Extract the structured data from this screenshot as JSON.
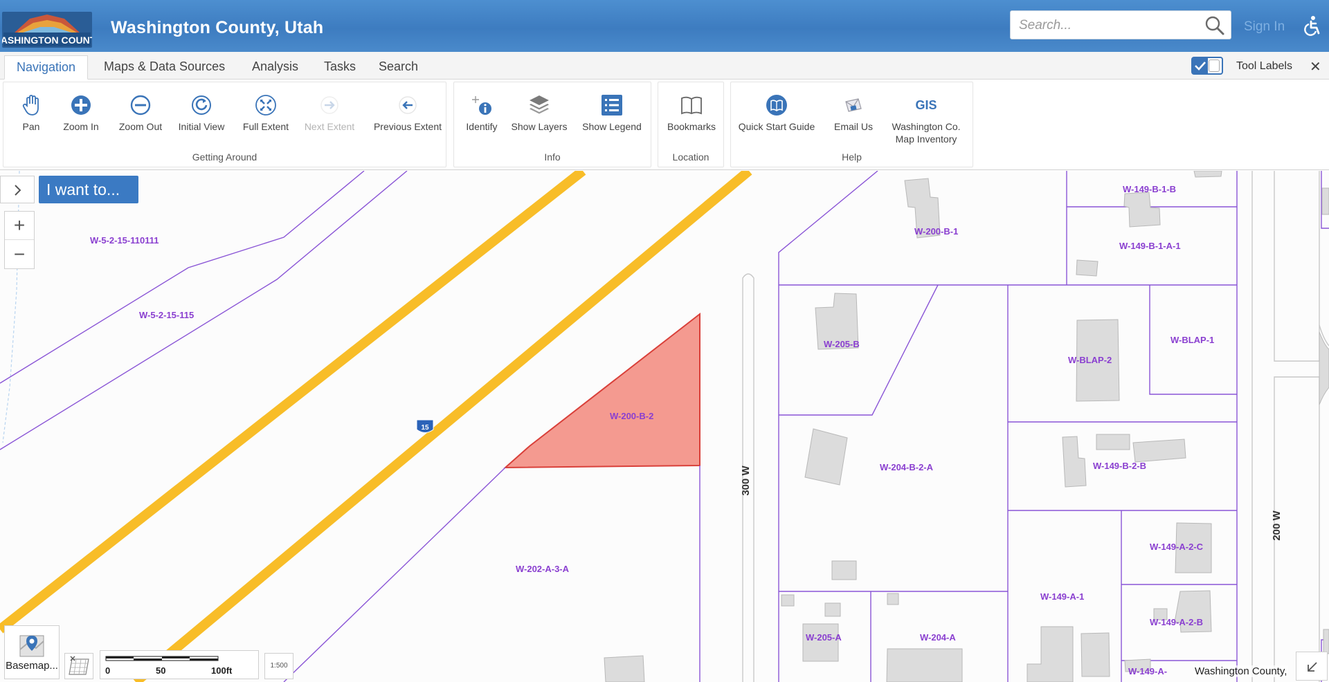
{
  "header": {
    "logo_text": "WASHINGTON COUNTY",
    "title": "Washington County, Utah",
    "search_placeholder": "Search...",
    "sign_in": "Sign In"
  },
  "tabs": [
    {
      "label": "Navigation",
      "active": true
    },
    {
      "label": "Maps & Data Sources",
      "active": false
    },
    {
      "label": "Analysis",
      "active": false
    },
    {
      "label": "Tasks",
      "active": false
    },
    {
      "label": "Search",
      "active": false
    }
  ],
  "tool_labels": {
    "label": "Tool Labels",
    "checked": true
  },
  "ribbon": {
    "groups": [
      {
        "label": "Getting Around",
        "tools": [
          {
            "label": "Pan",
            "icon": "hand-icon"
          },
          {
            "label": "Zoom In",
            "icon": "zoom-in-icon"
          },
          {
            "label": "Zoom Out",
            "icon": "zoom-out-icon"
          },
          {
            "label": "Initial View",
            "icon": "initial-view-icon"
          },
          {
            "label": "Full Extent",
            "icon": "full-extent-icon"
          },
          {
            "label": "Next Extent",
            "icon": "next-extent-icon",
            "disabled": true
          },
          {
            "label": "Previous Extent",
            "icon": "previous-extent-icon"
          }
        ]
      },
      {
        "label": "Info",
        "tools": [
          {
            "label": "Identify",
            "icon": "identify-icon"
          },
          {
            "label": "Show Layers",
            "icon": "layers-icon"
          },
          {
            "label": "Show Legend",
            "icon": "legend-icon"
          }
        ]
      },
      {
        "label": "Location",
        "tools": [
          {
            "label": "Bookmarks",
            "icon": "bookmark-icon"
          }
        ]
      },
      {
        "label": "Help",
        "tools": [
          {
            "label": "Quick Start Guide",
            "icon": "quick-start-icon"
          },
          {
            "label": "Email Us",
            "icon": "email-icon"
          },
          {
            "label": "Washington Co.",
            "label2": "Map Inventory",
            "icon": "gis-icon",
            "icon_text": "GIS"
          }
        ]
      }
    ]
  },
  "map": {
    "i_want_to": "I want to...",
    "zoom_in": "+",
    "zoom_out": "−",
    "basemap_label": "Basemap...",
    "scale": {
      "ticks": [
        "0",
        "50",
        "100ft"
      ],
      "input": "1:500"
    },
    "attribution": "Washington County,",
    "highway_shield": "15",
    "roads": [
      "300 W",
      "200 W"
    ],
    "parcels": [
      "W-5-2-15-110111",
      "W-5-2-15-115",
      "W-200-B-2",
      "W-202-A-3-A",
      "W-200-B-1",
      "W-149-B-1-B",
      "W-149-B-1-A-1",
      "W-205-B",
      "W-BLAP-2",
      "W-BLAP-1",
      "W-204-B-2-A",
      "W-149-B-2-B",
      "W-149-A-2-C",
      "W-149-A-1",
      "W-149-A-2-B",
      "W-205-A",
      "W-204-A",
      "W-149-A-"
    ],
    "colors": {
      "parcel_line": "#8a55d6",
      "highway": "#f8bd28",
      "selected_fill": "#f49a90",
      "selected_stroke": "#d9403a"
    }
  }
}
